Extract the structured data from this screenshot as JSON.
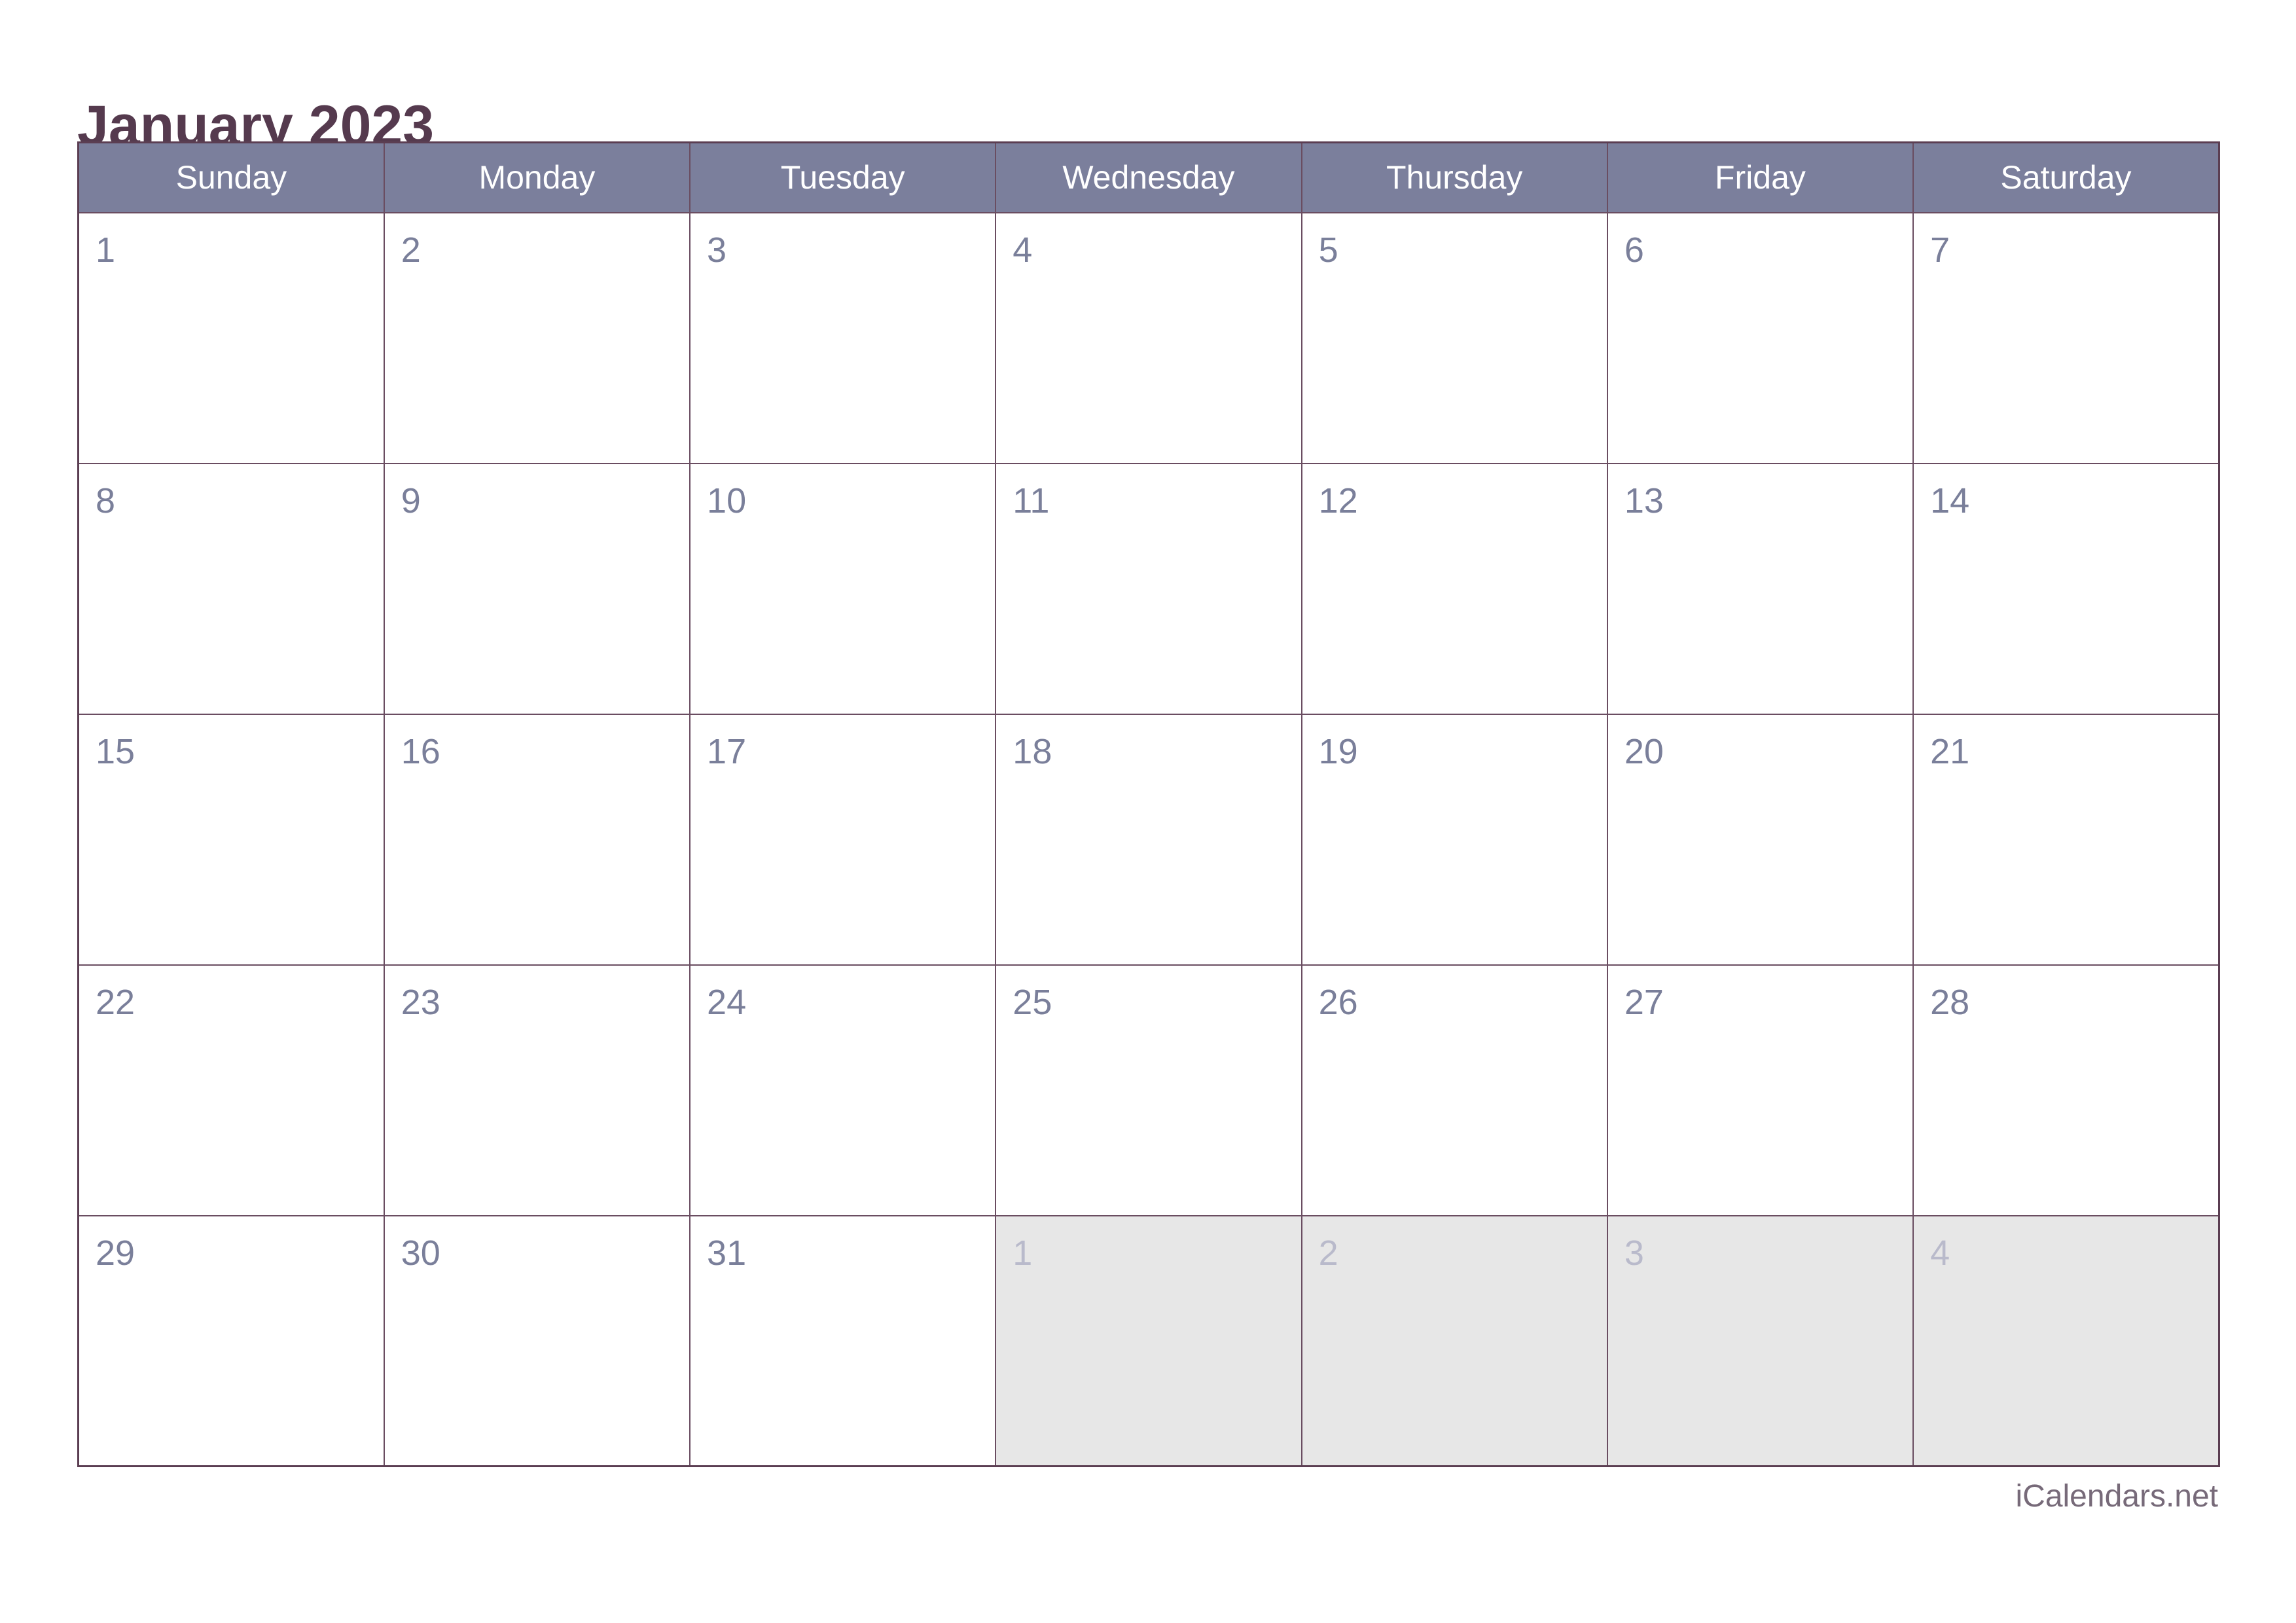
{
  "document": {
    "type": "monthly-calendar",
    "title": "January 2023",
    "month": "January",
    "year": "2023"
  },
  "colors": {
    "title_text": "#553a4e",
    "header_background": "#7b7f9c",
    "header_text": "#ffffff",
    "grid_border": "#6a4d61",
    "outer_border": "#5b3e52",
    "day_number": "#7a7f9a",
    "adjacent_day_number": "#b9bacb",
    "adjacent_cell_background": "#e7e7e7",
    "cell_background": "#ffffff",
    "footer_text": "#776a79",
    "page_background": "#ffffff"
  },
  "weekday_headers": [
    "Sunday",
    "Monday",
    "Tuesday",
    "Wednesday",
    "Thursday",
    "Friday",
    "Saturday"
  ],
  "weeks": [
    [
      {
        "day": "1",
        "adjacent": false
      },
      {
        "day": "2",
        "adjacent": false
      },
      {
        "day": "3",
        "adjacent": false
      },
      {
        "day": "4",
        "adjacent": false
      },
      {
        "day": "5",
        "adjacent": false
      },
      {
        "day": "6",
        "adjacent": false
      },
      {
        "day": "7",
        "adjacent": false
      }
    ],
    [
      {
        "day": "8",
        "adjacent": false
      },
      {
        "day": "9",
        "adjacent": false
      },
      {
        "day": "10",
        "adjacent": false
      },
      {
        "day": "11",
        "adjacent": false
      },
      {
        "day": "12",
        "adjacent": false
      },
      {
        "day": "13",
        "adjacent": false
      },
      {
        "day": "14",
        "adjacent": false
      }
    ],
    [
      {
        "day": "15",
        "adjacent": false
      },
      {
        "day": "16",
        "adjacent": false
      },
      {
        "day": "17",
        "adjacent": false
      },
      {
        "day": "18",
        "adjacent": false
      },
      {
        "day": "19",
        "adjacent": false
      },
      {
        "day": "20",
        "adjacent": false
      },
      {
        "day": "21",
        "adjacent": false
      }
    ],
    [
      {
        "day": "22",
        "adjacent": false
      },
      {
        "day": "23",
        "adjacent": false
      },
      {
        "day": "24",
        "adjacent": false
      },
      {
        "day": "25",
        "adjacent": false
      },
      {
        "day": "26",
        "adjacent": false
      },
      {
        "day": "27",
        "adjacent": false
      },
      {
        "day": "28",
        "adjacent": false
      }
    ],
    [
      {
        "day": "29",
        "adjacent": false
      },
      {
        "day": "30",
        "adjacent": false
      },
      {
        "day": "31",
        "adjacent": false
      },
      {
        "day": "1",
        "adjacent": true
      },
      {
        "day": "2",
        "adjacent": true
      },
      {
        "day": "3",
        "adjacent": true
      },
      {
        "day": "4",
        "adjacent": true
      }
    ]
  ],
  "footer": {
    "brand": "iCalendars.net"
  }
}
